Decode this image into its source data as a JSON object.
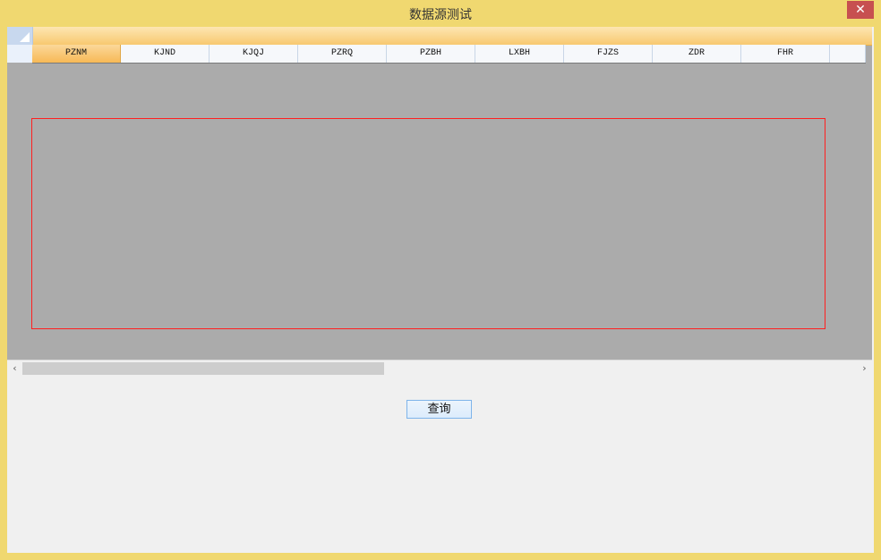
{
  "window": {
    "title": "数据源测试",
    "close_symbol": "✕"
  },
  "grid": {
    "columns": [
      "PZNM",
      "KJND",
      "KJQJ",
      "PZRQ",
      "PZBH",
      "LXBH",
      "FJZS",
      "ZDR",
      "FHR"
    ],
    "active_column": "PZNM"
  },
  "scrollbar": {
    "left_arrow": "‹",
    "right_arrow": "›"
  },
  "actions": {
    "query_label": "查询"
  },
  "colors": {
    "frame": "#f0d870",
    "grid_bg": "#ababab",
    "highlight_border": "#ff2020",
    "close_bg": "#c75050"
  }
}
